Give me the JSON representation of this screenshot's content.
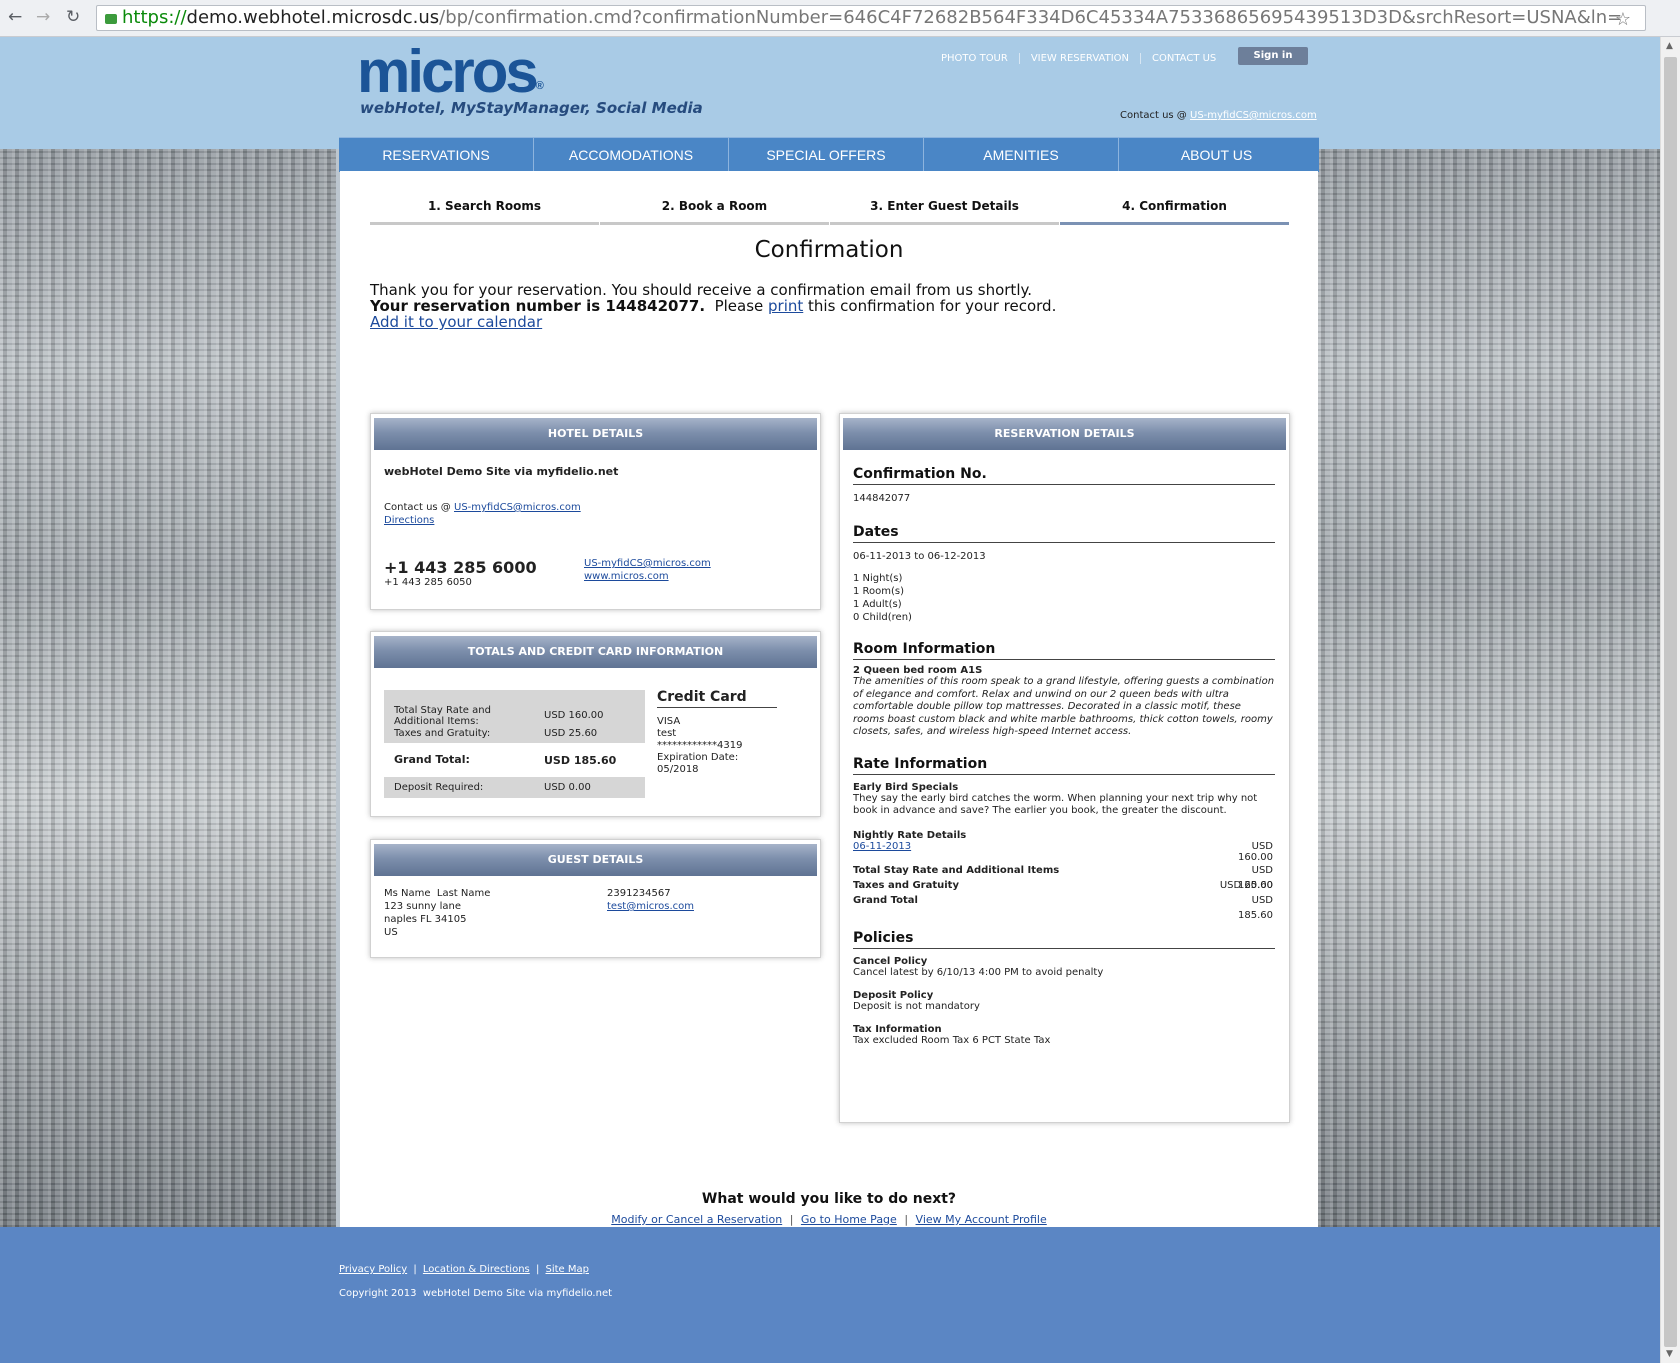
{
  "browser": {
    "url_https": "https://",
    "url_host": "demo.webhotel.microsdc.us",
    "url_rest": "/bp/confirmation.cmd?confirmationNumber=646C4F72682B564F334D6C45334A75336865695439513D3D&srchResort=USNA&ln="
  },
  "header": {
    "logo": "micros",
    "tagline": "webHotel, MyStayManager, Social Media",
    "links": [
      "PHOTO TOUR",
      "VIEW RESERVATION",
      "CONTACT US"
    ],
    "signin": "Sign in",
    "contact_label": "Contact us @ ",
    "contact_email": "US-myfidCS@micros.com"
  },
  "menu": [
    "RESERVATIONS",
    "ACCOMODATIONS",
    "SPECIAL OFFERS",
    "AMENITIES",
    "ABOUT US"
  ],
  "steps": [
    "1. Search Rooms",
    "2. Book a Room",
    "3. Enter Guest Details",
    "4. Confirmation"
  ],
  "title": "Confirmation",
  "thanks": {
    "line1": "Thank you for your reservation. You should receive a confirmation email from us shortly.",
    "line2_bold": "Your reservation number is 144842077.",
    "line2_pre": "  Please ",
    "print": "print",
    "line2_post": " this confirmation for your record.",
    "calendar": "Add it to your calendar"
  },
  "hotel": {
    "heading": "HOTEL DETAILS",
    "name": "webHotel Demo Site via myfidelio.net",
    "contact_label": "Contact us @ ",
    "contact_email": "US-myfidCS@micros.com",
    "directions": "Directions",
    "phone": "+1 443 285 6000",
    "phone2": "+1 443 285 6050",
    "email": "US-myfidCS@micros.com",
    "web": "www.micros.com"
  },
  "totals": {
    "heading": "TOTALS AND CREDIT CARD INFORMATION",
    "rows": [
      {
        "label": "Total Stay Rate and Additional Items:",
        "value": "USD 160.00"
      },
      {
        "label": "Taxes and Gratuity:",
        "value": "USD 25.60"
      },
      {
        "label": "Grand Total:",
        "value": "USD 185.60"
      },
      {
        "label": "Deposit Required:",
        "value": "USD 0.00"
      }
    ],
    "cc_title": "Credit Card",
    "cc_type": "VISA",
    "cc_name": "test",
    "cc_number": "************4319",
    "cc_exp": "Expiration Date: 05/2018"
  },
  "guest": {
    "heading": "GUEST DETAILS",
    "name": "Ms Name  Last Name",
    "address1": "123 sunny lane",
    "address2": "naples FL 34105",
    "country": "US",
    "phone": "2391234567",
    "email": "test@micros.com"
  },
  "reservation": {
    "heading": "RESERVATION DETAILS",
    "conf_title": "Confirmation No.",
    "conf_no": "144842077",
    "dates_title": "Dates",
    "dates": "06-11-2013 to 06-12-2013",
    "nights": "1 Night(s)",
    "rooms": "1 Room(s)",
    "adults": "1 Adult(s)",
    "children": "0 Child(ren)",
    "room_title": "Room Information",
    "room_name": "2 Queen bed room A1S",
    "room_desc": "The amenities of this room speak to a grand lifestyle, offering guests a combination of elegance and comfort. Relax and unwind on our 2 queen beds with ultra comfortable double pillow top mattresses. Decorated in a classic motif, these rooms boast custom black and white marble bathrooms, thick cotton towels, roomy closets, safes, and wireless high-speed Internet access.",
    "rate_title": "Rate Information",
    "rate_name": "Early Bird Specials",
    "rate_desc": "They say the early bird catches the worm. When planning your next trip why not book in advance and save? The earlier you book, the greater the discount.",
    "nightly_title": "Nightly Rate Details",
    "nightly_date": "06-11-2013",
    "nightly_amount": "USD 160.00",
    "total_label": "Total Stay Rate and Additional Items",
    "total_amount": "USD 160.00",
    "tax_label": "Taxes and Gratuity",
    "tax_amount": "USD 25.60",
    "grand_label": "Grand Total",
    "grand_amount": "USD 185.60",
    "policies_title": "Policies",
    "cancel_title": "Cancel Policy",
    "cancel_text": "Cancel latest by 6/10/13 4:00 PM to avoid penalty",
    "deposit_title": "Deposit Policy",
    "deposit_text": "Deposit is not mandatory",
    "tax_title": "Tax Information",
    "tax_text": "Tax excluded Room Tax 6 PCT State Tax"
  },
  "next": {
    "title": "What would you like to do next?",
    "links": [
      "Modify or Cancel a Reservation",
      "Go to Home Page",
      "View My Account Profile"
    ]
  },
  "footer": {
    "links": [
      "Privacy Policy",
      "Location & Directions",
      "Site Map"
    ],
    "copyright": "Copyright 2013  webHotel Demo Site via myfidelio.net"
  }
}
